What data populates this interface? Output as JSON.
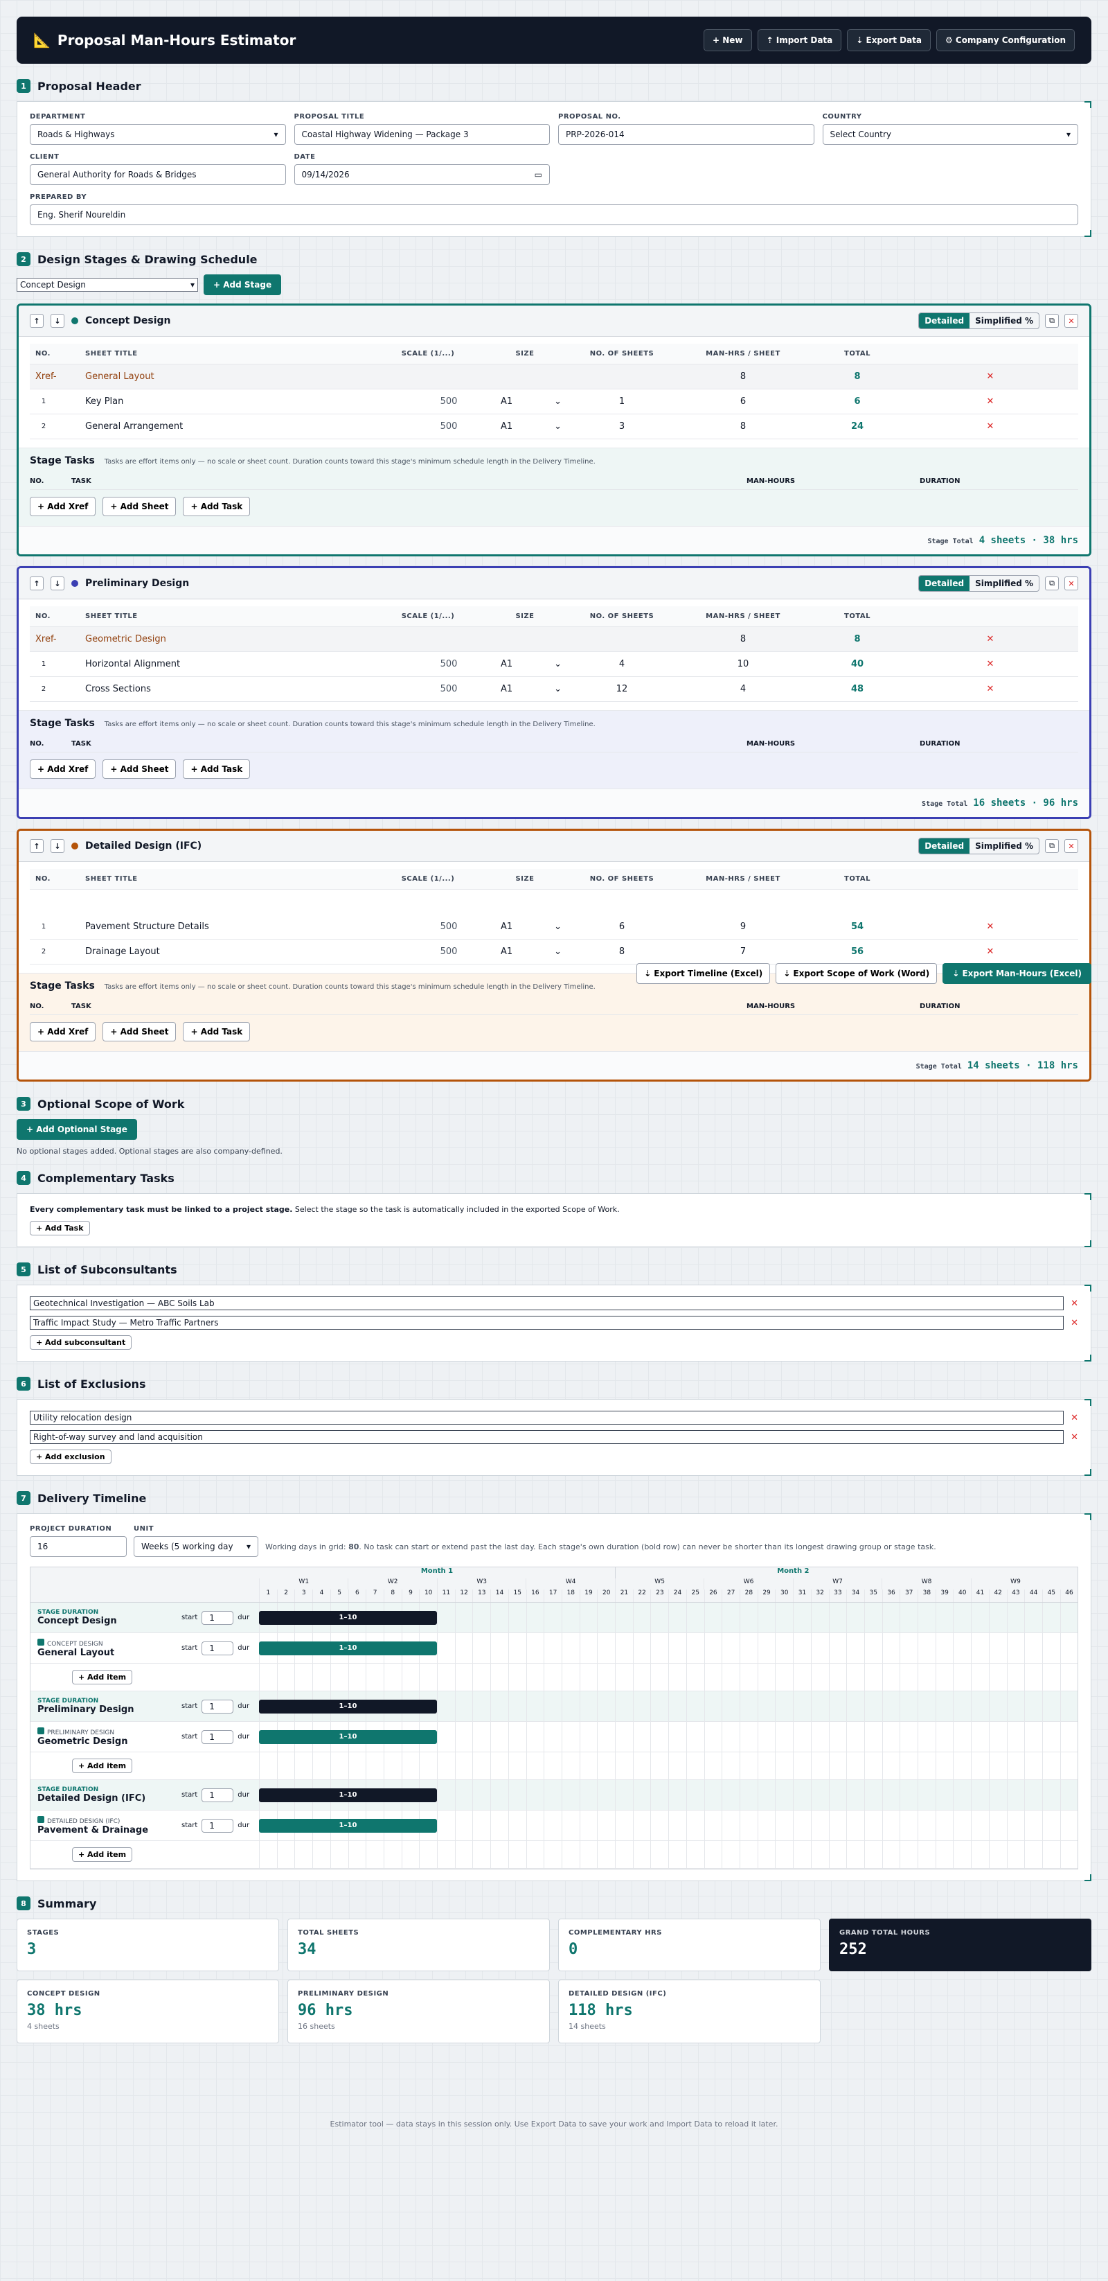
{
  "app": {
    "title": "Proposal Man-Hours Estimator",
    "buttons": [
      "+ New",
      "⇡ Import Data",
      "⇣ Export Data",
      "⚙ Company Configuration"
    ]
  },
  "header": {
    "title": "Proposal Header",
    "fields": [
      {
        "label": "DEPARTMENT",
        "value": "Roads & Highways"
      },
      {
        "label": "PROPOSAL TITLE",
        "value": "Coastal Highway Widening — Package 3"
      },
      {
        "label": "PROPOSAL NO.",
        "value": "PRP-2026-014"
      },
      {
        "label": "COUNTRY",
        "value": "Select Country"
      },
      {
        "label": "CLIENT",
        "value": "General Authority for Roads & Bridges"
      },
      {
        "label": "DATE",
        "value": "09/14/2026"
      }
    ],
    "prepared_label": "PREPARED BY",
    "prepared_value": "Eng. Sherif Noureldin"
  },
  "stages_section": {
    "title": "Design Stages & Drawing Schedule",
    "select": "Concept Design",
    "add": "+ Add Stage"
  },
  "cols": [
    "NO.",
    "SHEET TITLE",
    "SCALE (1/...)",
    "SIZE",
    "NO. OF SHEETS",
    "MAN-HRS / SHEET",
    "TOTAL"
  ],
  "toggle": [
    "Detailed",
    "Simplified %"
  ],
  "tasks_title": "Stage Tasks",
  "tasks_note": "Tasks are effort items only — no scale or sheet count. Duration counts toward this stage's minimum schedule length in the Delivery Timeline.",
  "task_cols": [
    "NO.",
    "TASK",
    "MAN-HOURS",
    "DURATION"
  ],
  "add_btns": [
    "+ Add Xref",
    "+ Add Sheet",
    "+ Add Task"
  ],
  "stage_total_label": "Stage Total",
  "stages": [
    {
      "name": "Concept Design",
      "color": "#0f766e",
      "xref": {
        "prefix": "Xref-",
        "title": "General Layout",
        "mh": "8",
        "total": "8"
      },
      "rows": [
        {
          "no": "1",
          "title": "Key Plan",
          "scale": "500",
          "size": "A1",
          "sheets": "1",
          "mh": "6",
          "total": "6"
        },
        {
          "no": "2",
          "title": "General Arrangement",
          "scale": "500",
          "size": "A1",
          "sheets": "3",
          "mh": "8",
          "total": "24"
        }
      ],
      "total": "4 sheets · 38 hrs"
    },
    {
      "name": "Preliminary Design",
      "color": "#3b3fb3",
      "xref": {
        "prefix": "Xref-",
        "title": "Geometric Design",
        "mh": "8",
        "total": "8"
      },
      "rows": [
        {
          "no": "1",
          "title": "Horizontal Alignment",
          "scale": "500",
          "size": "A1",
          "sheets": "4",
          "mh": "10",
          "total": "40"
        },
        {
          "no": "2",
          "title": "Cross Sections",
          "scale": "500",
          "size": "A1",
          "sheets": "12",
          "mh": "4",
          "total": "48"
        }
      ],
      "total": "16 sheets · 96 hrs"
    },
    {
      "name": "Detailed Design (IFC)",
      "color": "#b45309",
      "rows": [
        {
          "no": "1",
          "title": "Pavement Structure Details",
          "scale": "500",
          "size": "A1",
          "sheets": "6",
          "mh": "9",
          "total": "54"
        },
        {
          "no": "2",
          "title": "Drainage Layout",
          "scale": "500",
          "size": "A1",
          "sheets": "8",
          "mh": "7",
          "total": "56"
        }
      ],
      "total": "14 sheets · 118 hrs"
    }
  ],
  "export_btns": [
    "⇣ Export Timeline (Excel)",
    "⇣ Export Scope of Work (Word)",
    "⇣ Export Man-Hours (Excel)"
  ],
  "optional": {
    "title": "Optional Scope of Work",
    "add": "+ Add Optional Stage",
    "note": "No optional stages added. Optional stages are also company-defined."
  },
  "complementary": {
    "title": "Complementary Tasks",
    "bold": "Every complementary task must be linked to a project stage.",
    "note": " Select the stage so the task is automatically included in the exported Scope of Work.",
    "add": "+ Add Task"
  },
  "subconsultants": {
    "title": "List of Subconsultants",
    "items": [
      "Geotechnical Investigation — ABC Soils Lab",
      "Traffic Impact Study — Metro Traffic Partners"
    ],
    "add": "+ Add subconsultant"
  },
  "exclusions": {
    "title": "List of Exclusions",
    "items": [
      "Utility relocation design",
      "Right-of-way survey and land acquisition"
    ],
    "add": "+ Add exclusion"
  },
  "timeline": {
    "title": "Delivery Timeline",
    "duration_label": "PROJECT DURATION",
    "duration": "16",
    "unit_label": "UNIT",
    "unit": "Weeks (5 working day",
    "note_pre": "Working days in grid: ",
    "note_bold": "80",
    "note_post": ". No task can start or extend past the last day. Each stage's own duration (bold row) can never be shorter than its longest drawing group or stage task.",
    "months": [
      "Month 1",
      "Month 2"
    ],
    "weeks": [
      "W1",
      "W2",
      "W3",
      "W4",
      "W5",
      "W6",
      "W7",
      "W8",
      "W9"
    ],
    "stage_dur_label": "STAGE DURATION",
    "start": "start",
    "dur": "dur",
    "start_val": "1",
    "bar": "1–10",
    "add_item": "+ Add item",
    "groups": [
      {
        "stage": "Concept Design",
        "sub": "CONCEPT DESIGN",
        "item": "General Layout"
      },
      {
        "stage": "Preliminary Design",
        "sub": "PRELIMINARY DESIGN",
        "item": "Geometric Design"
      },
      {
        "stage": "Detailed Design (IFC)",
        "sub": "DETAILED DESIGN (IFC)",
        "item": "Pavement & Drainage"
      }
    ]
  },
  "summary": {
    "title": "Summary",
    "cards": [
      {
        "k": "STAGES",
        "v": "3"
      },
      {
        "k": "TOTAL SHEETS",
        "v": "34"
      },
      {
        "k": "COMPLEMENTARY HRS",
        "v": "0"
      },
      {
        "k": "GRAND TOTAL HOURS",
        "v": "252"
      }
    ],
    "stage_cards": [
      {
        "k": "CONCEPT DESIGN",
        "v": "38 hrs",
        "s": "4 sheets"
      },
      {
        "k": "PRELIMINARY DESIGN",
        "v": "96 hrs",
        "s": "16 sheets"
      },
      {
        "k": "DETAILED DESIGN (IFC)",
        "v": "118 hrs",
        "s": "14 sheets"
      }
    ]
  },
  "footer": "Estimator tool — data stays in this session only. Use Export Data to save your work and Import Data to reload it later."
}
